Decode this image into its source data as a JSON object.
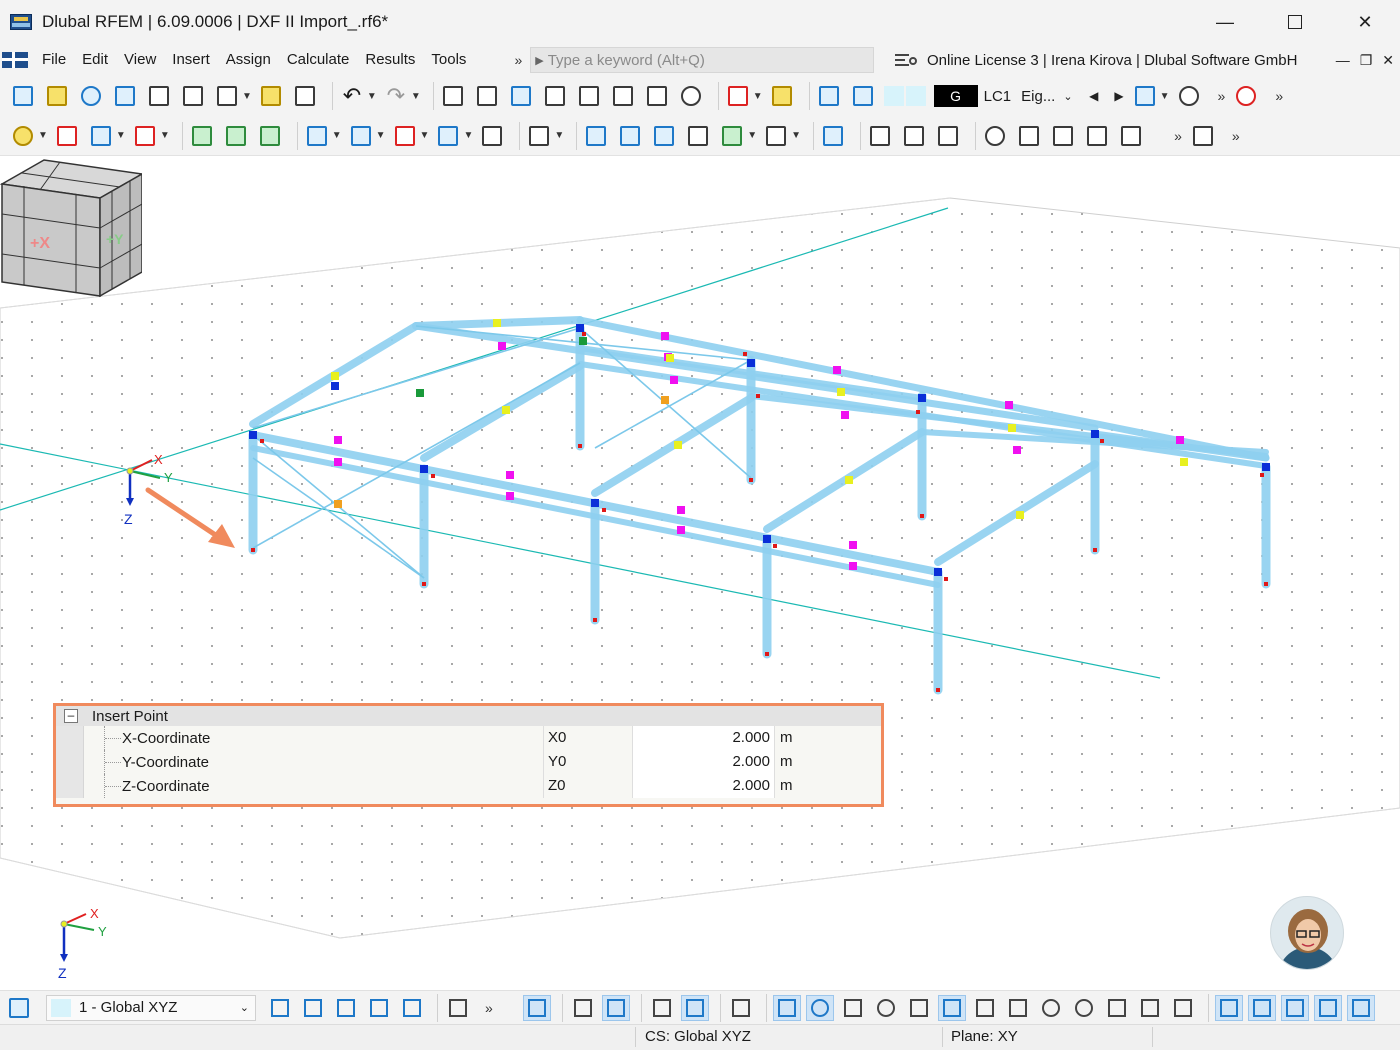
{
  "window": {
    "title": "Dlubal RFEM | 6.09.0006 | DXF II Import_.rf6*",
    "controls": [
      "minimize",
      "maximize",
      "close"
    ]
  },
  "menu": {
    "items": [
      "File",
      "Edit",
      "View",
      "Insert",
      "Assign",
      "Calculate",
      "Results",
      "Tools"
    ],
    "more": "»",
    "search_placeholder": "Type a keyword (Alt+Q)",
    "license": "Online License 3 | Irena Kirova | Dlubal Software GmbH"
  },
  "toolbar": {
    "load_case_color": "G",
    "load_case": "LC1",
    "load_case_type": "Eig..."
  },
  "viewport": {
    "axis_labels": {
      "x": "X",
      "y": "Y",
      "z": "Z"
    },
    "navcube_labels": {
      "x": "+X",
      "y": "+Y"
    }
  },
  "insert_point": {
    "title": "Insert Point",
    "rows": [
      {
        "label": "X-Coordinate",
        "symbol": "X0",
        "value": "2.000",
        "unit": "m"
      },
      {
        "label": "Y-Coordinate",
        "symbol": "Y0",
        "value": "2.000",
        "unit": "m"
      },
      {
        "label": "Z-Coordinate",
        "symbol": "Z0",
        "value": "2.000",
        "unit": "m"
      }
    ]
  },
  "bottom": {
    "coordinate_system": "1 - Global XYZ"
  },
  "status": {
    "cs": "CS: Global XYZ",
    "plane": "Plane: XY"
  },
  "colors": {
    "member": "#8fd0f0",
    "highlight": "#f08a5d",
    "axis_x": "#e02020",
    "axis_y": "#20a040",
    "axis_z": "#1030c0",
    "node_blue": "#0a2fd8",
    "node_magenta": "#f010f0",
    "node_yellow": "#e8f020",
    "grid_line": "#1bb9b3"
  }
}
